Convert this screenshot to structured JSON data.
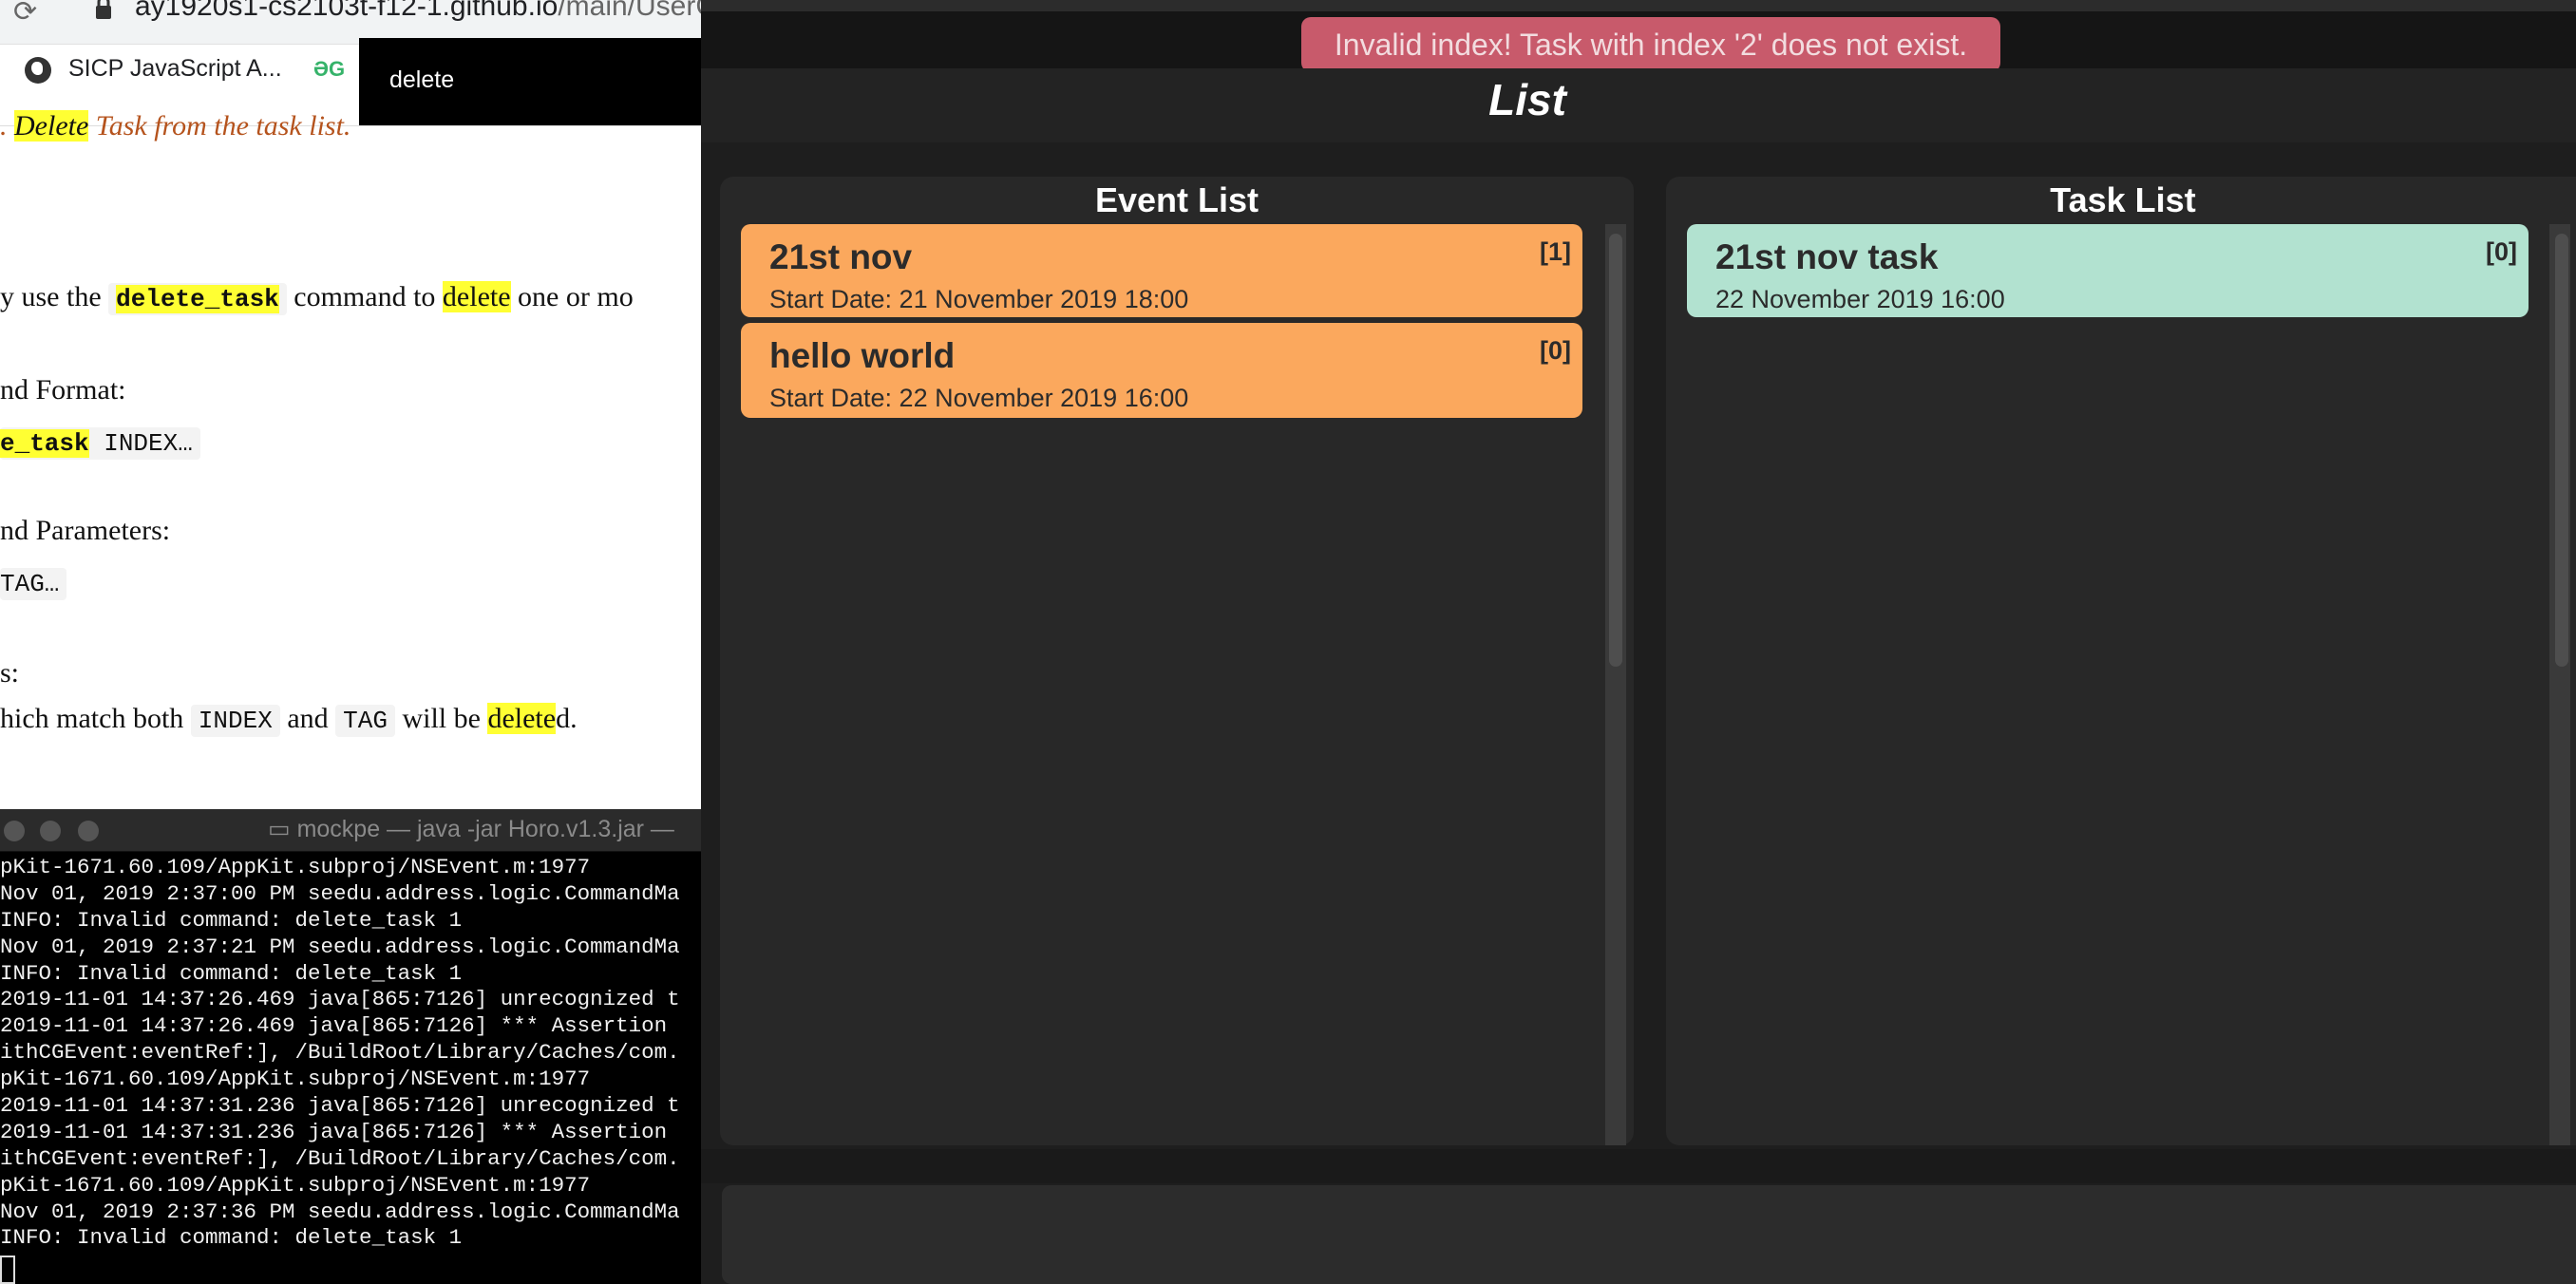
{
  "browser": {
    "url_host": "ay1920s1-cs2103t-f12-1.github.io",
    "url_path": "/main/UserG",
    "bookmark_label": "SICP JavaScript A...",
    "find_query": "delete",
    "doc": {
      "heading_prefix": ". ",
      "heading_highlight": "Delete",
      "heading_rest": " Task from the task list.",
      "p1_a": "y use the ",
      "p1_code": "delete_task",
      "p1_b": " command to ",
      "p1_hl": "delete",
      "p1_c": " one or mo",
      "format_label": "nd Format:",
      "format_code_hl": "e_task",
      "format_code_rest": " INDEX…",
      "params_label": "nd Parameters:",
      "params_code": "TAG…",
      "s_label": "s:",
      "p2_a": "hich match both ",
      "p2_code1": "INDEX",
      "p2_b": " and ",
      "p2_code2": "TAG",
      "p2_c": " will be ",
      "p2_hl": "delete",
      "p2_d": "d."
    }
  },
  "terminal": {
    "title": "mockpe — java -jar Horo.v1.3.jar —",
    "lines": [
      "pKit-1671.60.109/AppKit.subproj/NSEvent.m:1977",
      "Nov 01, 2019 2:37:00 PM seedu.address.logic.CommandMa",
      "INFO: Invalid command: delete_task 1",
      "Nov 01, 2019 2:37:21 PM seedu.address.logic.CommandMa",
      "INFO: Invalid command: delete_task 1",
      "2019-11-01 14:37:26.469 java[865:7126] unrecognized t",
      "2019-11-01 14:37:26.469 java[865:7126] *** Assertion",
      "ithCGEvent:eventRef:], /BuildRoot/Library/Caches/com.",
      "pKit-1671.60.109/AppKit.subproj/NSEvent.m:1977",
      "2019-11-01 14:37:31.236 java[865:7126] unrecognized t",
      "2019-11-01 14:37:31.236 java[865:7126] *** Assertion",
      "ithCGEvent:eventRef:], /BuildRoot/Library/Caches/com.",
      "pKit-1671.60.109/AppKit.subproj/NSEvent.m:1977",
      "Nov 01, 2019 2:37:36 PM seedu.address.logic.CommandMa",
      "INFO: Invalid command: delete_task 1"
    ]
  },
  "app": {
    "error_message": "Invalid index! Task with index '2' does not exist.",
    "list_title": "List",
    "event_list": {
      "title": "Event List",
      "items": [
        {
          "name": "21st nov",
          "date": "Start Date: 21 November 2019 18:00",
          "index": "[1]"
        },
        {
          "name": "hello world",
          "date": "Start Date: 22 November 2019 16:00",
          "index": "[0]"
        }
      ]
    },
    "task_list": {
      "title": "Task List",
      "items": [
        {
          "name": "21st nov task",
          "date": "22 November 2019 16:00",
          "index": "[0]"
        }
      ]
    },
    "command_box_value": "",
    "colors": {
      "event_card": "#fba85d",
      "task_card": "#b2e2d0",
      "error_banner": "#c85a6b",
      "background": "#1e1e1e"
    }
  }
}
